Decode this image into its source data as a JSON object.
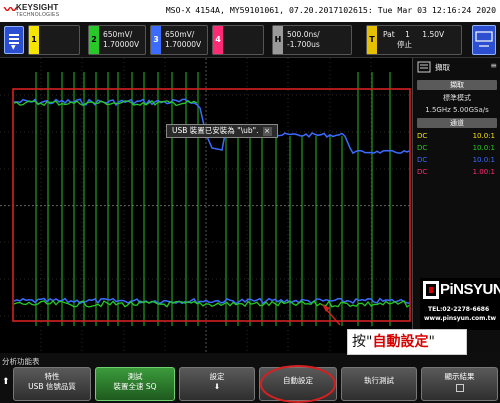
{
  "header": {
    "brand": "KEYSIGHT",
    "brand_sub": "TECHNOLOGIES",
    "scope_info": "MSO-X 4154A, MY59101061, 07.20.2017102615: Tue Mar 03 12:16:24 2020"
  },
  "channels": [
    {
      "num": "1",
      "line1": "",
      "line2": "",
      "color": "#f4e400"
    },
    {
      "num": "2",
      "line1": "650mV/",
      "line2": "1.70000V",
      "color": "#28c828"
    },
    {
      "num": "3",
      "line1": "650mV/",
      "line2": "1.70000V",
      "color": "#3b6cff"
    },
    {
      "num": "4",
      "line1": "",
      "line2": "",
      "color": "#ff2a74"
    }
  ],
  "horizontal": {
    "badge": "H",
    "line1": "500.0ns/",
    "line2": "-1.700us"
  },
  "trigger": {
    "badge": "T",
    "pat": "Pat",
    "channel": "1",
    "level": "1.50V",
    "state": "停止"
  },
  "notification": {
    "text": "USB 裝置已安裝為 \"\\ub\".",
    "close": "×"
  },
  "right_panel": {
    "title": "擷取",
    "acquire_header": "擷取",
    "mode": "標準模式",
    "rate": "1.5GHz  5.00GSa/s",
    "channel_header": "通道",
    "channels": [
      {
        "coupling": "DC",
        "probe": "10.0:1",
        "color": "#f4e400"
      },
      {
        "coupling": "DC",
        "probe": "10.0:1",
        "color": "#28c828"
      },
      {
        "coupling": "DC",
        "probe": "10.0:1",
        "color": "#3b6cff"
      },
      {
        "coupling": "DC",
        "probe": "1.00:1",
        "color": "#ff2a74"
      }
    ]
  },
  "watermark": {
    "name": "PiNSYUN",
    "tel": "TEL:02-2278-6686",
    "url": "www.pinsyun.com.tw"
  },
  "bottom": {
    "func_label": "分析功能表",
    "softkeys": [
      {
        "line1": "特性",
        "line2": "USB 信號品質"
      },
      {
        "line1": "測試",
        "line2": "裝置全速 SQ"
      },
      {
        "line1": "設定",
        "line2": ""
      },
      {
        "line1": "自動設定",
        "line2": ""
      },
      {
        "line1": "執行測試",
        "line2": ""
      },
      {
        "line1": "顯示結果",
        "line2": ""
      }
    ]
  },
  "callout": {
    "prefix": "按\"",
    "highlight": "自動設定",
    "suffix": "\""
  },
  "colors": {
    "highlight_red": "#d60000",
    "ch2": "#28c828",
    "ch3": "#3b6cff"
  }
}
